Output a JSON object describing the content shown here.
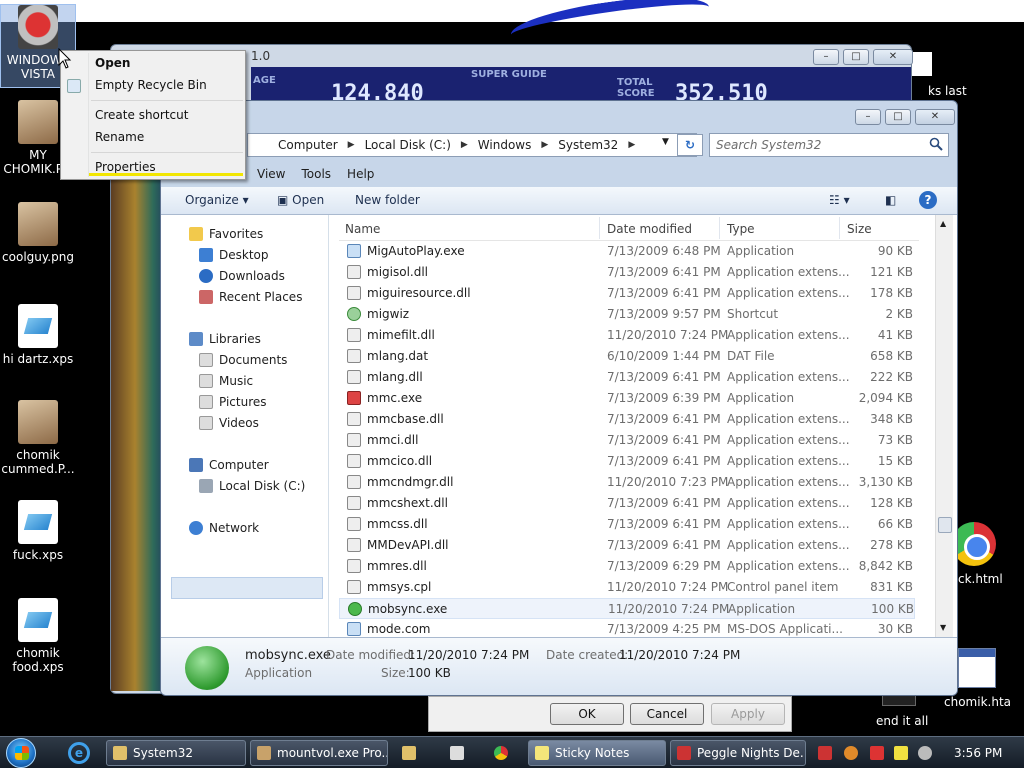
{
  "desktop": {
    "icons": [
      {
        "label": "WINDOWS VISTA",
        "thumb": "recycle"
      },
      {
        "label": "MY CHOMIK.P...",
        "thumb": "photo"
      },
      {
        "label": "coolguy.png",
        "thumb": "photo"
      },
      {
        "label": "hi dartz.xps",
        "thumb": "xps"
      },
      {
        "label": "chomik cummed.P...",
        "thumb": "photo"
      },
      {
        "label": "fuck.xps",
        "thumb": "xps"
      },
      {
        "label": "chomik food.xps",
        "thumb": "xps"
      }
    ],
    "right_fragments": {
      "top": "ks last",
      "html": "ck.html",
      "hta": "chomik.hta",
      "end": "end it all"
    }
  },
  "peggle": {
    "title": "1.0",
    "label_left": "AGE",
    "score_left": "124.840",
    "badge": "SUPER GUIDE",
    "label_total": "TOTAL SCORE",
    "score_total": "352.510"
  },
  "explorer": {
    "breadcrumb": [
      "Computer",
      "Local Disk (C:)",
      "Windows",
      "System32"
    ],
    "search_placeholder": "Search System32",
    "menu": [
      "View",
      "Tools",
      "Help"
    ],
    "commands": {
      "organize": "Organize",
      "open": "Open",
      "new_folder": "New folder"
    },
    "nav": {
      "favorites": "Favorites",
      "desktop": "Desktop",
      "downloads": "Downloads",
      "recent": "Recent Places",
      "libraries": "Libraries",
      "documents": "Documents",
      "music": "Music",
      "pictures": "Pictures",
      "videos": "Videos",
      "computer": "Computer",
      "local_disk": "Local Disk (C:)",
      "network": "Network"
    },
    "columns": {
      "name": "Name",
      "date": "Date modified",
      "type": "Type",
      "size": "Size"
    },
    "files": [
      {
        "name": "MigAutoPlay.exe",
        "date": "7/13/2009 6:48 PM",
        "type": "Application",
        "size": "90 KB",
        "icon": "exe"
      },
      {
        "name": "migisol.dll",
        "date": "7/13/2009 6:41 PM",
        "type": "Application extens...",
        "size": "121 KB",
        "icon": "dll"
      },
      {
        "name": "miguiresource.dll",
        "date": "7/13/2009 6:41 PM",
        "type": "Application extens...",
        "size": "178 KB",
        "icon": "dll"
      },
      {
        "name": "migwiz",
        "date": "7/13/2009 9:57 PM",
        "type": "Shortcut",
        "size": "2 KB",
        "icon": "lnk"
      },
      {
        "name": "mimefilt.dll",
        "date": "11/20/2010 7:24 PM",
        "type": "Application extens...",
        "size": "41 KB",
        "icon": "dll"
      },
      {
        "name": "mlang.dat",
        "date": "6/10/2009 1:44 PM",
        "type": "DAT File",
        "size": "658 KB",
        "icon": "dll"
      },
      {
        "name": "mlang.dll",
        "date": "7/13/2009 6:41 PM",
        "type": "Application extens...",
        "size": "222 KB",
        "icon": "dll"
      },
      {
        "name": "mmc.exe",
        "date": "7/13/2009 6:39 PM",
        "type": "Application",
        "size": "2,094 KB",
        "icon": "mmc"
      },
      {
        "name": "mmcbase.dll",
        "date": "7/13/2009 6:41 PM",
        "type": "Application extens...",
        "size": "348 KB",
        "icon": "dll"
      },
      {
        "name": "mmci.dll",
        "date": "7/13/2009 6:41 PM",
        "type": "Application extens...",
        "size": "73 KB",
        "icon": "dll"
      },
      {
        "name": "mmcico.dll",
        "date": "7/13/2009 6:41 PM",
        "type": "Application extens...",
        "size": "15 KB",
        "icon": "dll"
      },
      {
        "name": "mmcndmgr.dll",
        "date": "11/20/2010 7:23 PM",
        "type": "Application extens...",
        "size": "3,130 KB",
        "icon": "dll"
      },
      {
        "name": "mmcshext.dll",
        "date": "7/13/2009 6:41 PM",
        "type": "Application extens...",
        "size": "128 KB",
        "icon": "dll"
      },
      {
        "name": "mmcss.dll",
        "date": "7/13/2009 6:41 PM",
        "type": "Application extens...",
        "size": "66 KB",
        "icon": "dll"
      },
      {
        "name": "MMDevAPI.dll",
        "date": "7/13/2009 6:41 PM",
        "type": "Application extens...",
        "size": "278 KB",
        "icon": "dll"
      },
      {
        "name": "mmres.dll",
        "date": "7/13/2009 6:29 PM",
        "type": "Application extens...",
        "size": "8,842 KB",
        "icon": "dll"
      },
      {
        "name": "mmsys.cpl",
        "date": "11/20/2010 7:24 PM",
        "type": "Control panel item",
        "size": "831 KB",
        "icon": "dll"
      },
      {
        "name": "mobsync.exe",
        "date": "11/20/2010 7:24 PM",
        "type": "Application",
        "size": "100 KB",
        "icon": "sync",
        "selected": true
      },
      {
        "name": "mode.com",
        "date": "7/13/2009 4:25 PM",
        "type": "MS-DOS Applicati...",
        "size": "30 KB",
        "icon": "exe"
      }
    ],
    "details": {
      "name": "mobsync.exe",
      "type": "Application",
      "modified_label": "Date modified:",
      "modified_value": "11/20/2010 7:24 PM",
      "created_label": "Date created:",
      "created_value": "11/20/2010 7:24 PM",
      "size_label": "Size:",
      "size_value": "100 KB"
    }
  },
  "properties_dialog": {
    "ok": "OK",
    "cancel": "Cancel",
    "apply": "Apply"
  },
  "context_menu": {
    "open": "Open",
    "empty": "Empty Recycle Bin",
    "create_shortcut": "Create shortcut",
    "rename": "Rename",
    "properties": "Properties"
  },
  "taskbar": {
    "buttons": [
      "System32",
      "mountvol.exe Pro...",
      "Sticky Notes",
      "Peggle Nights De..."
    ],
    "clock": "3:56 PM"
  }
}
